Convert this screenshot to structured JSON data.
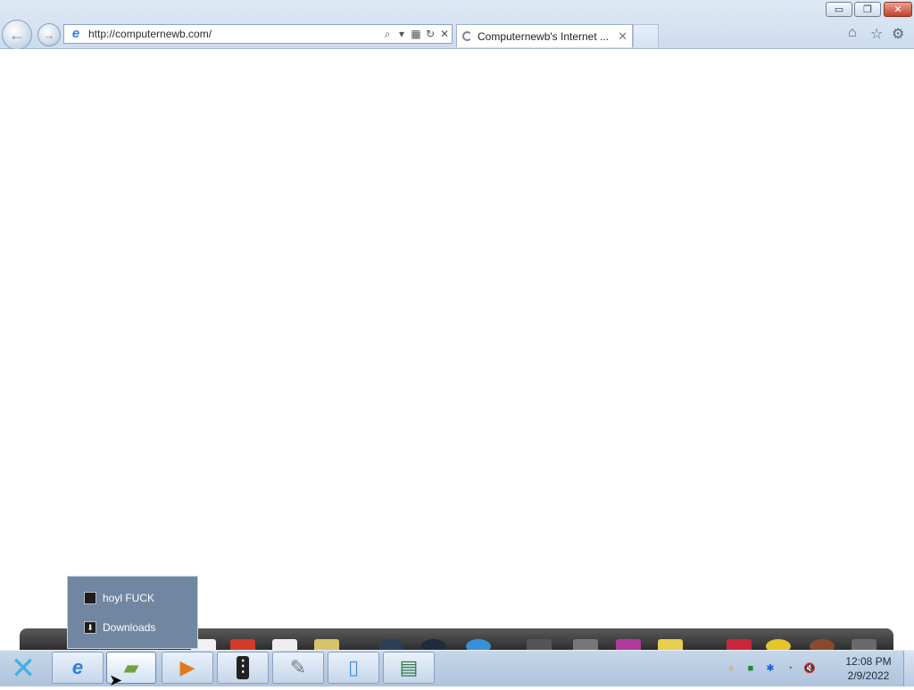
{
  "browser": {
    "url": "http://computernewb.com/",
    "tab_title": "Computernewb's Internet ...",
    "window_controls": {
      "minimize": "▭",
      "restore": "❐",
      "close": "✕"
    },
    "nav": {
      "back": "←",
      "forward": "→"
    },
    "address_icons": {
      "search": "⌕",
      "dropdown": "▾",
      "compat": "▦",
      "refresh": "↻",
      "stop": "✕"
    },
    "command_icons": {
      "home": "⌂",
      "favorites": "☆",
      "tools": "⚙"
    },
    "tab_close": "✕"
  },
  "jumplist": {
    "items": [
      {
        "label": "hoyl FUCK",
        "icon": "book-icon"
      },
      {
        "label": "Downloads",
        "icon": "download-icon"
      }
    ]
  },
  "taskbar": {
    "start_glyph": "✕",
    "buttons": [
      {
        "name": "internet-explorer",
        "glyph": "e",
        "color": "#2a7de1",
        "active": false
      },
      {
        "name": "file-explorer",
        "glyph": "▰",
        "color": "#6da33c",
        "active": true
      },
      {
        "name": "media-player",
        "glyph": "▶",
        "color": "#e07a1c",
        "active": false
      },
      {
        "name": "mixer",
        "glyph": "⫶",
        "color": "#ffffff",
        "active": false
      },
      {
        "name": "notepad",
        "glyph": "✎",
        "color": "#777777",
        "active": false
      },
      {
        "name": "blank-document",
        "glyph": "▯",
        "color": "#4c8dd6",
        "active": false
      },
      {
        "name": "network-monitor",
        "glyph": "▤",
        "color": "#2f7b4a",
        "active": false
      }
    ],
    "tray": [
      "⟡",
      "■",
      "✱",
      "◔",
      "🔇"
    ],
    "clock_time": "12:08 PM",
    "clock_date": "2/9/2022"
  },
  "colors": {
    "chrome_bg": "#dfe9f5",
    "taskbar_bg": "#aec3dc",
    "jumplist_bg": "#7186a1",
    "dock_bg": "#3a3a3a"
  }
}
